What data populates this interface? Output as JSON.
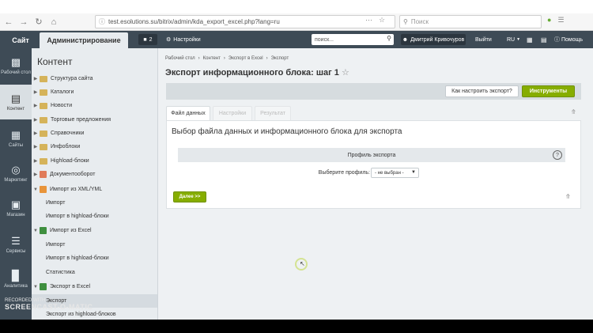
{
  "browser": {
    "url": "test.esolutions.su/bitrix/admin/kda_export_excel.php?lang=ru",
    "search_placeholder": "Поиск"
  },
  "header": {
    "site_tab": "Сайт",
    "admin_tab": "Администрирование",
    "notifications_count": "2",
    "settings": "Настройки",
    "search_value": "поиск...",
    "user": "Дмитрий Кривочуров",
    "logout": "Выйти",
    "lang": "RU",
    "help": "Помощь"
  },
  "rail": {
    "items": [
      {
        "label": "Рабочий стол"
      },
      {
        "label": "Контент"
      },
      {
        "label": "Сайты"
      },
      {
        "label": "Маркетинг"
      },
      {
        "label": "Магазин"
      },
      {
        "label": "Сервисы"
      },
      {
        "label": "Аналитика"
      }
    ]
  },
  "sidebar": {
    "title": "Контент",
    "items": [
      {
        "label": "Структура сайта"
      },
      {
        "label": "Каталоги"
      },
      {
        "label": "Новости"
      },
      {
        "label": "Торговые предложения"
      },
      {
        "label": "Справочники"
      },
      {
        "label": "Инфоблоки"
      },
      {
        "label": "Highload-блоки"
      },
      {
        "label": "Документооборот"
      },
      {
        "label": "Импорт из XML/YML"
      },
      {
        "label": "Импорт"
      },
      {
        "label": "Импорт в highload-блоки"
      },
      {
        "label": "Импорт из Excel"
      },
      {
        "label": "Импорт"
      },
      {
        "label": "Импорт в highload-блоки"
      },
      {
        "label": "Статистика"
      },
      {
        "label": "Экспорт в Excel"
      },
      {
        "label": "Экспорт"
      },
      {
        "label": "Экспорт из highload-блоков"
      }
    ]
  },
  "main": {
    "breadcrumb": [
      "Рабочий стол",
      "Контент",
      "Экспорт в Excel",
      "Экспорт"
    ],
    "title": "Экспорт информационного блока: шаг 1",
    "how_button": "Как настроить экспорт?",
    "tools_button": "Инструменты",
    "tabs": [
      {
        "label": "Файл данных"
      },
      {
        "label": "Настройки"
      },
      {
        "label": "Результат"
      }
    ],
    "panel_title": "Выбор файла данных и информационного блока для экспорта",
    "profile_header": "Профиль экспорта",
    "help_mark": "?",
    "profile_label": "Выберите профиль:",
    "profile_value": "- не выбран -",
    "next_button": "Далее >>"
  },
  "watermark": {
    "line1": "RECORDED WITH",
    "line2": "SCREENCAST-O-MATIC"
  }
}
